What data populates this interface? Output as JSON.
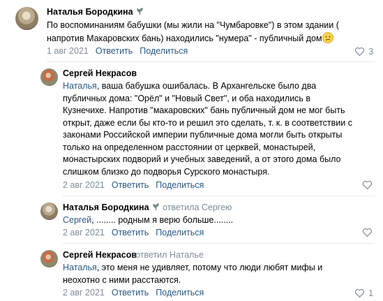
{
  "comments": [
    {
      "author": "Наталья Бородкина",
      "text": "По воспоминаниям бабушки (мы жили на \"Чумбаровке\") в этом здании ( напротив Макаровских бань) находились \"нумера\" - публичный дом",
      "emoji": "confused-face-icon",
      "date": "1 авг 2021",
      "reply_label": "Ответить",
      "share_label": "Поделиться",
      "likes": "3"
    },
    {
      "author": "Сергей Некрасов",
      "mention": "Наталья",
      "text": ", ваша бабушка ошибалась. В Архангельске было два публичных дома: \"Орёл\" и \"Новый Свет\", и оба находились в Кузнечихе. Напротив \"макаровских\" бань публичный дом не мог быть открыт, даже если бы кто-то и решил это сделать, т. к. в соответствии с законами Российской империи публичные дома могли быть открыты только на определенном расстоянии от церквей, монастырей, монастырских подворий и учебных заведений, а от этого дома было слишком близко до подворья Сурского монастыря.",
      "date": "2 авг 2021",
      "reply_label": "Ответить",
      "share_label": "Поделиться"
    },
    {
      "author": "Наталья Бородкина",
      "replied_to": "ответила Сергею",
      "mention": "Сергей",
      "text": ", ........ родным я верю больше........",
      "date": "2 авг 2021",
      "reply_label": "Ответить",
      "share_label": "Поделиться"
    },
    {
      "author": "Сергей Некрасов",
      "replied_to": "ответил Наталье",
      "mention": "Наталья",
      "text": ", это меня не удивляет, потому что люди любят мифы и неохотно с ними расстаются.",
      "date": "2 авг 2021",
      "reply_label": "Ответить",
      "share_label": "Поделиться",
      "likes": "1"
    }
  ],
  "colors": {
    "link": "#2a5885",
    "muted": "#818c99",
    "divider": "#e7e8ec"
  }
}
